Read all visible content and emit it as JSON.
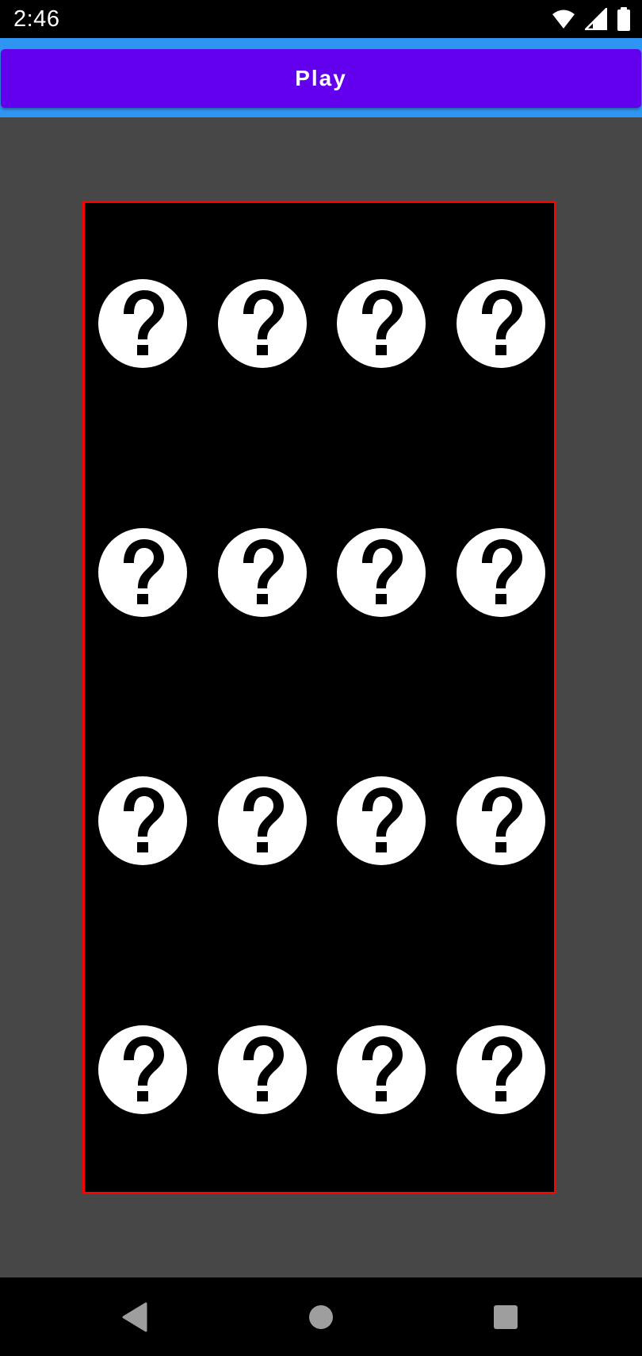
{
  "status_bar": {
    "time": "2:46",
    "icons": [
      "wifi-icon",
      "cellular-signal-icon",
      "battery-icon"
    ]
  },
  "toolbar": {
    "play_label": "Play"
  },
  "board": {
    "rows": 4,
    "columns": 4,
    "card_face": "question-mark-icon",
    "border_color": "#ff0000",
    "background_color": "#000000"
  },
  "nav_bar": {
    "buttons": [
      "back-icon",
      "home-icon",
      "recents-icon"
    ]
  },
  "colors": {
    "accent": "#6200ee",
    "top_band": "#2f95f3",
    "page_background": "#474747"
  }
}
